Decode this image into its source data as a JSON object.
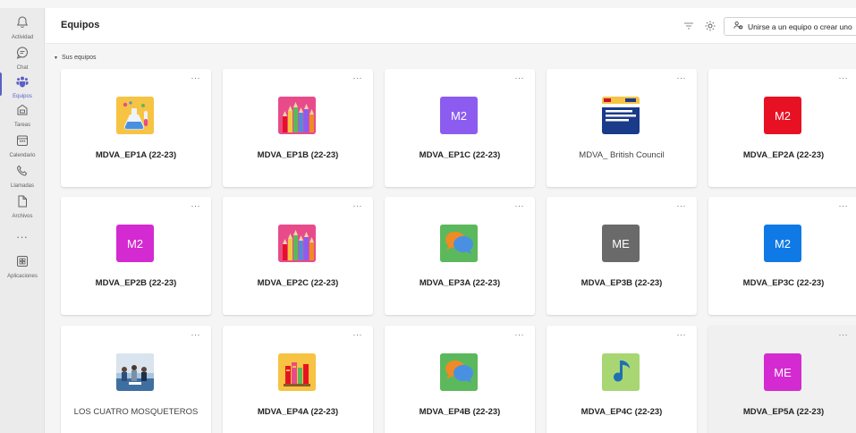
{
  "rail": {
    "items": [
      {
        "label": "Actividad",
        "icon": "bell-icon"
      },
      {
        "label": "Chat",
        "icon": "chat-icon"
      },
      {
        "label": "Equipos",
        "icon": "teams-icon"
      },
      {
        "label": "Tareas",
        "icon": "assignments-icon"
      },
      {
        "label": "Calendario",
        "icon": "calendar-icon"
      },
      {
        "label": "Llamadas",
        "icon": "phone-icon"
      },
      {
        "label": "Archivos",
        "icon": "file-icon"
      }
    ],
    "more": "...",
    "apps_label": "Aplicaciones"
  },
  "header": {
    "title": "Equipos",
    "join_label": "Unirse a un equipo o crear uno"
  },
  "section": {
    "label": "Sus equipos"
  },
  "more_glyph": "···",
  "teams": [
    {
      "name": "MDVA_EP1A (22-23)",
      "avatar_type": "image",
      "avatar_image": "science-flask",
      "avatar_bg": "#f6c343"
    },
    {
      "name": "MDVA_EP1B (22-23)",
      "avatar_type": "image",
      "avatar_image": "colored-pencils",
      "avatar_bg": "#e84b8a"
    },
    {
      "name": "MDVA_EP1C (22-23)",
      "avatar_type": "initials",
      "initials": "M2",
      "avatar_bg": "#8c5cf0"
    },
    {
      "name": "MDVA_ British Council",
      "avatar_type": "image",
      "avatar_image": "bilingual-school-logo",
      "avatar_bg": "#1a3a8a",
      "normal_weight": true
    },
    {
      "name": "MDVA_EP2A (22-23)",
      "avatar_type": "initials",
      "initials": "M2",
      "avatar_bg": "#e81123"
    },
    {
      "name": "MDVA_EP2B (22-23)",
      "avatar_type": "initials",
      "initials": "M2",
      "avatar_bg": "#d42ad1"
    },
    {
      "name": "MDVA_EP2C (22-23)",
      "avatar_type": "image",
      "avatar_image": "colored-pencils",
      "avatar_bg": "#e84b8a"
    },
    {
      "name": "MDVA_EP3A (22-23)",
      "avatar_type": "image",
      "avatar_image": "speech-bubbles",
      "avatar_bg": "#5cb85c"
    },
    {
      "name": "MDVA_EP3B (22-23)",
      "avatar_type": "initials",
      "initials": "ME",
      "avatar_bg": "#6a6a6a"
    },
    {
      "name": "MDVA_EP3C (22-23)",
      "avatar_type": "initials",
      "initials": "M2",
      "avatar_bg": "#0f7ae5"
    },
    {
      "name": "LOS CUATRO MOSQUETEROS",
      "avatar_type": "image",
      "avatar_image": "classroom-photo",
      "avatar_bg": "#6f8fb0",
      "normal_weight": true
    },
    {
      "name": "MDVA_EP4A (22-23)",
      "avatar_type": "image",
      "avatar_image": "books",
      "avatar_bg": "#f6c343"
    },
    {
      "name": "MDVA_EP4B (22-23)",
      "avatar_type": "image",
      "avatar_image": "speech-bubbles",
      "avatar_bg": "#5cb85c"
    },
    {
      "name": "MDVA_EP4C (22-23)",
      "avatar_type": "image",
      "avatar_image": "music-note",
      "avatar_bg": "#a8d672"
    },
    {
      "name": "MDVA_EP5A (22-23)",
      "avatar_type": "initials",
      "initials": "ME",
      "avatar_bg": "#d42ad1",
      "hovered": true
    }
  ],
  "colors": {
    "accent": "#5b5fc7"
  }
}
